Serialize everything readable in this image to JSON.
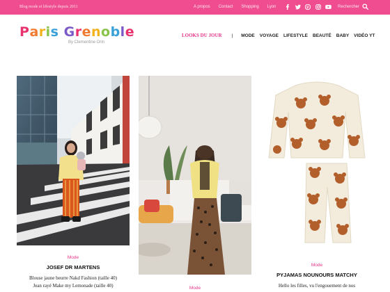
{
  "topbar": {
    "tagline": "Blog mode et lifestyle depuis 2011",
    "links": [
      "A propos",
      "Contact",
      "Shopping",
      "Lyon"
    ],
    "social_icons": [
      "facebook-icon",
      "twitter-icon",
      "pinterest-icon",
      "instagram-icon",
      "youtube-icon"
    ],
    "search_label": "Rechercher",
    "color": "#ef4d8f"
  },
  "header": {
    "logo_text": "Paris Grenoble",
    "logo_colors": [
      "#e8336f",
      "#f07a2f",
      "#f2b21c",
      "#8ac34a",
      "#3aa0d8",
      "#7b5ac8"
    ],
    "byline": "By Clementine Orin"
  },
  "nav": {
    "feature": "LOOKS DU JOUR",
    "separator": "|",
    "items": [
      "MODE",
      "VOYAGE",
      "LIFESTYLE",
      "BEAUTÉ",
      "BABY",
      "VIDÉO YT"
    ],
    "accent": "#e6358a"
  },
  "posts": [
    {
      "category": "Mode",
      "title": "JOSEF DR MARTENS",
      "excerpt_lines": [
        "Blouse jaune beurre Nakd Fashion (taille 40)",
        "Jean rayé Make my Lemonade (taille 40)"
      ]
    },
    {
      "category": "Mode"
    },
    {
      "category": "Mode",
      "title": "PYJAMAS NOUNOURS MATCHY",
      "excerpt_lines": [
        "Hello les filles, vu l'engouement de nos"
      ]
    }
  ]
}
